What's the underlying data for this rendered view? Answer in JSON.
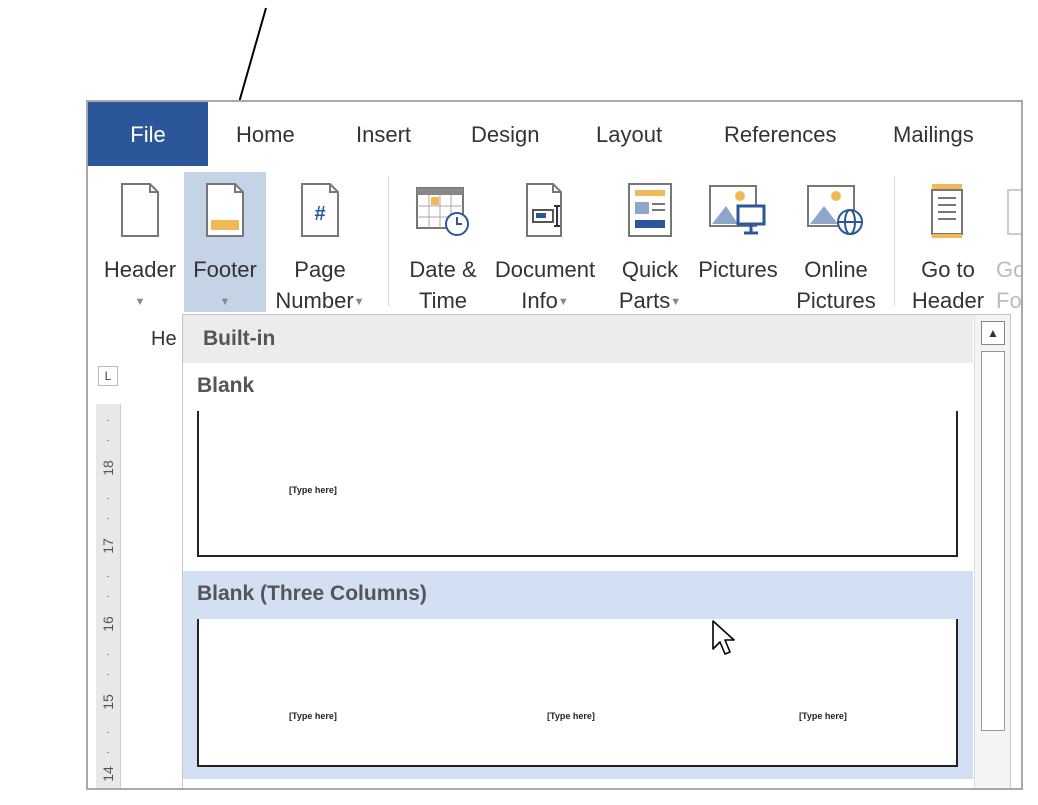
{
  "tabs": [
    {
      "label": "File"
    },
    {
      "label": "Home"
    },
    {
      "label": "Insert"
    },
    {
      "label": "Design"
    },
    {
      "label": "Layout"
    },
    {
      "label": "References"
    },
    {
      "label": "Mailings"
    }
  ],
  "ribbon": {
    "header": {
      "line1": "Header",
      "line2": ""
    },
    "footer": {
      "line1": "Footer",
      "line2": ""
    },
    "page_number": {
      "line1": "Page",
      "line2": "Number"
    },
    "date_time": {
      "line1": "Date &",
      "line2": "Time"
    },
    "document_info": {
      "line1": "Document",
      "line2": "Info"
    },
    "quick_parts": {
      "line1": "Quick",
      "line2": "Parts"
    },
    "pictures": {
      "line1": "Pictures",
      "line2": ""
    },
    "online_pictures": {
      "line1": "Online",
      "line2": "Pictures"
    },
    "go_to_header": {
      "line1": "Go to",
      "line2": "Header"
    },
    "go_to_footer": {
      "line1": "Go",
      "line2": "Fo"
    },
    "group_label": "He"
  },
  "ruler": {
    "corner": "L",
    "numbers": [
      "18",
      "17",
      "16",
      "15",
      "14"
    ]
  },
  "gallery": {
    "section": "Built-in",
    "items": [
      {
        "title": "Blank",
        "placeholders": [
          "[Type here]"
        ]
      },
      {
        "title": "Blank (Three Columns)",
        "placeholders": [
          "[Type here]",
          "[Type here]",
          "[Type here]"
        ]
      }
    ]
  },
  "colors": {
    "file_tab": "#2b579a",
    "active_button": "#c5d3e6",
    "hover_item": "#d3e0f3",
    "accent_orange": "#f0b955"
  }
}
